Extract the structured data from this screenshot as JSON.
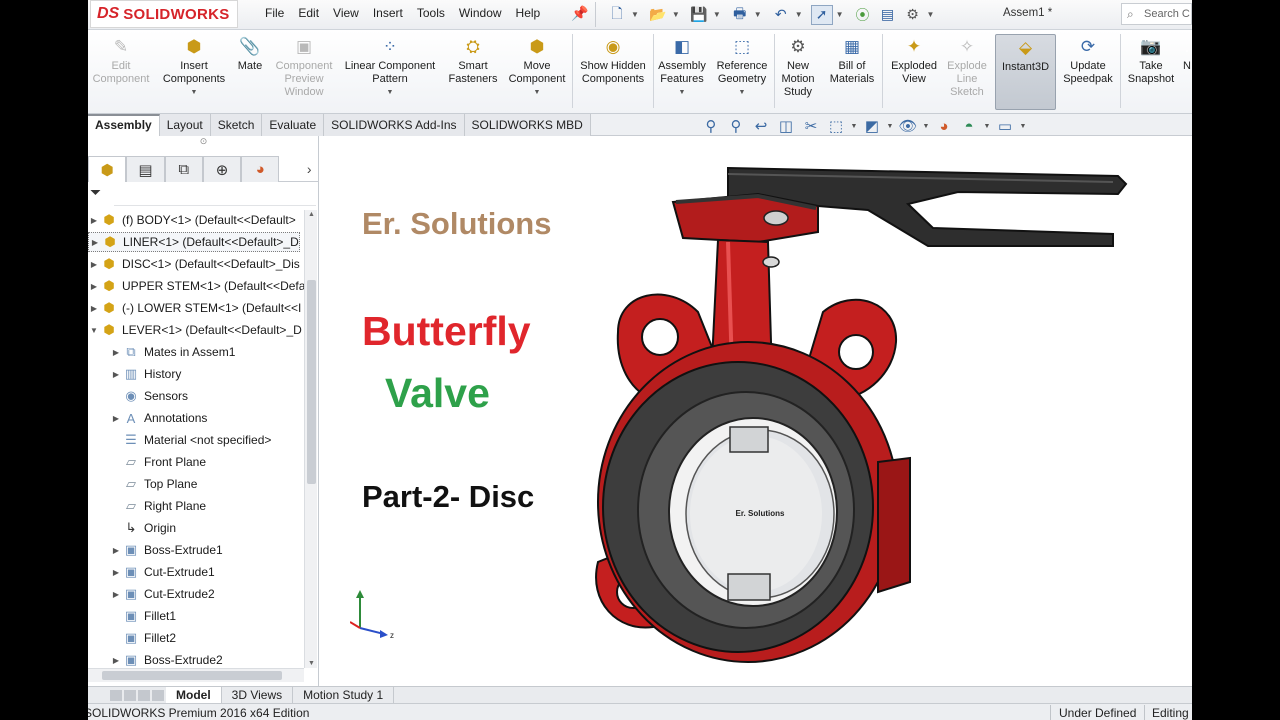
{
  "app": {
    "logo_prefix": "DS",
    "logo_text": "SOLIDWORKS",
    "document_title": "Assem1 *",
    "search_placeholder": "Search C"
  },
  "menu": [
    "File",
    "Edit",
    "View",
    "Insert",
    "Tools",
    "Window",
    "Help"
  ],
  "ribbon": {
    "edit_component": "Edit Component",
    "insert_components": "Insert Components",
    "mate": "Mate",
    "component_preview_window": "Component Preview Window",
    "linear_component_pattern": "Linear Component Pattern",
    "smart_fasteners": "Smart Fasteners",
    "move_component": "Move Component",
    "show_hidden_components": "Show Hidden Components",
    "assembly_features": "Assembly Features",
    "reference_geometry": "Reference Geometry",
    "new_motion_study": "New Motion Study",
    "bill_of_materials": "Bill of Materials",
    "exploded_view": "Exploded View",
    "explode_line_sketch": "Explode Line Sketch",
    "instant3d": "Instant3D",
    "update_speedpak": "Update Speedpak",
    "take_snapshot": "Take Snapshot",
    "more": "N"
  },
  "command_tabs": [
    "Assembly",
    "Layout",
    "Sketch",
    "Evaluate",
    "SOLIDWORKS Add-Ins",
    "SOLIDWORKS MBD"
  ],
  "tree": [
    {
      "label": "(f) BODY<1> (Default<<Default>",
      "type": "component",
      "expand": "▶",
      "indent": 0
    },
    {
      "label": "LINER<1> (Default<<Default>_D",
      "type": "component",
      "expand": "▶",
      "indent": 0,
      "selected": true
    },
    {
      "label": "DISC<1> (Default<<Default>_Dis",
      "type": "component",
      "expand": "▶",
      "indent": 0
    },
    {
      "label": "UPPER STEM<1> (Default<<Defa",
      "type": "component",
      "expand": "▶",
      "indent": 0
    },
    {
      "label": "(-) LOWER STEM<1> (Default<<I",
      "type": "component",
      "expand": "▶",
      "indent": 0
    },
    {
      "label": "LEVER<1> (Default<<Default>_D",
      "type": "component",
      "expand": "▼",
      "indent": 0
    },
    {
      "label": "Mates in Assem1",
      "type": "mates",
      "expand": "▶",
      "indent": 1
    },
    {
      "label": "History",
      "type": "history",
      "expand": "▶",
      "indent": 1
    },
    {
      "label": "Sensors",
      "type": "sensors",
      "expand": "",
      "indent": 1
    },
    {
      "label": "Annotations",
      "type": "annotations",
      "expand": "▶",
      "indent": 1
    },
    {
      "label": "Material <not specified>",
      "type": "material",
      "expand": "",
      "indent": 1
    },
    {
      "label": "Front Plane",
      "type": "plane",
      "expand": "",
      "indent": 1
    },
    {
      "label": "Top Plane",
      "type": "plane",
      "expand": "",
      "indent": 1
    },
    {
      "label": "Right Plane",
      "type": "plane",
      "expand": "",
      "indent": 1
    },
    {
      "label": "Origin",
      "type": "origin",
      "expand": "",
      "indent": 1
    },
    {
      "label": "Boss-Extrude1",
      "type": "feature",
      "expand": "▶",
      "indent": 1
    },
    {
      "label": "Cut-Extrude1",
      "type": "feature",
      "expand": "▶",
      "indent": 1
    },
    {
      "label": "Cut-Extrude2",
      "type": "feature",
      "expand": "▶",
      "indent": 1
    },
    {
      "label": "Fillet1",
      "type": "feature",
      "expand": "",
      "indent": 1
    },
    {
      "label": "Fillet2",
      "type": "feature",
      "expand": "",
      "indent": 1
    },
    {
      "label": "Boss-Extrude2",
      "type": "feature",
      "expand": "▶",
      "indent": 1
    }
  ],
  "viewport": {
    "brand": "Er. Solutions",
    "title_line1": "Butterfly",
    "title_line2": "Valve",
    "subtitle": "Part-2- Disc",
    "disc_engraving": "Er. Solutions",
    "brand_color": "#b08965",
    "title1_color": "#e0262c",
    "title2_color": "#2ea14a"
  },
  "bottom_tabs": [
    "Model",
    "3D Views",
    "Motion Study 1"
  ],
  "status": {
    "product": "SOLIDWORKS Premium 2016 x64 Edition",
    "definition": "Under Defined",
    "mode": "Editing"
  },
  "icons": {
    "tree_component": "component-icon",
    "tree_feature": "feature-icon",
    "tree_plane": "plane-icon",
    "tree_origin": "origin-icon"
  }
}
